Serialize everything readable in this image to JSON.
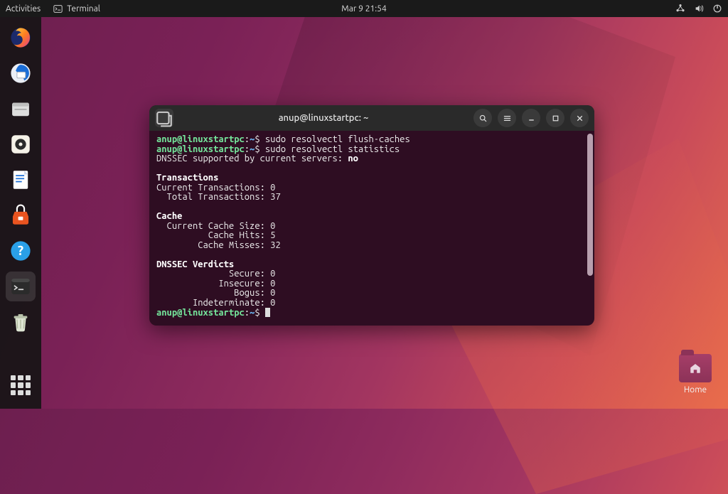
{
  "topbar": {
    "activities": "Activities",
    "app_label": "Terminal",
    "clock": "Mar 9  21:54"
  },
  "dock": {
    "items": [
      {
        "name": "firefox",
        "color": "#ff7139"
      },
      {
        "name": "thunderbird",
        "color": "#1f6fd0"
      },
      {
        "name": "files",
        "color": "#d9d9d9"
      },
      {
        "name": "rhythmbox",
        "color": "#f5f2e8"
      },
      {
        "name": "libreoffice-writer",
        "color": "#1a6dd6"
      },
      {
        "name": "software",
        "color": "#e95420"
      },
      {
        "name": "help",
        "color": "#2aa0e8"
      },
      {
        "name": "terminal",
        "color": "#333"
      },
      {
        "name": "trash",
        "color": "#d0d6c8"
      }
    ]
  },
  "desktop": {
    "home_label": "Home"
  },
  "terminal": {
    "title": "anup@linuxstartpc: ~",
    "prompt_user": "anup@linuxstartpc",
    "prompt_path": "~",
    "commands": {
      "cmd1": "sudo resolvectl flush-caches",
      "cmd2": "sudo resolvectl statistics"
    },
    "output": {
      "dnssec_supported_label": "DNSSEC supported by current servers: ",
      "dnssec_supported_value": "no",
      "transactions_header": "Transactions",
      "transactions": [
        {
          "label": "Current Transactions:",
          "value": "0"
        },
        {
          "label": "  Total Transactions:",
          "value": "37"
        }
      ],
      "cache_header": "Cache",
      "cache": [
        {
          "label": "  Current Cache Size:",
          "value": "0"
        },
        {
          "label": "          Cache Hits:",
          "value": "5"
        },
        {
          "label": "        Cache Misses:",
          "value": "32"
        }
      ],
      "dnssec_header": "DNSSEC Verdicts",
      "dnssec": [
        {
          "label": "              Secure:",
          "value": "0"
        },
        {
          "label": "            Insecure:",
          "value": "0"
        },
        {
          "label": "               Bogus:",
          "value": "0"
        },
        {
          "label": "       Indeterminate:",
          "value": "0"
        }
      ]
    }
  }
}
